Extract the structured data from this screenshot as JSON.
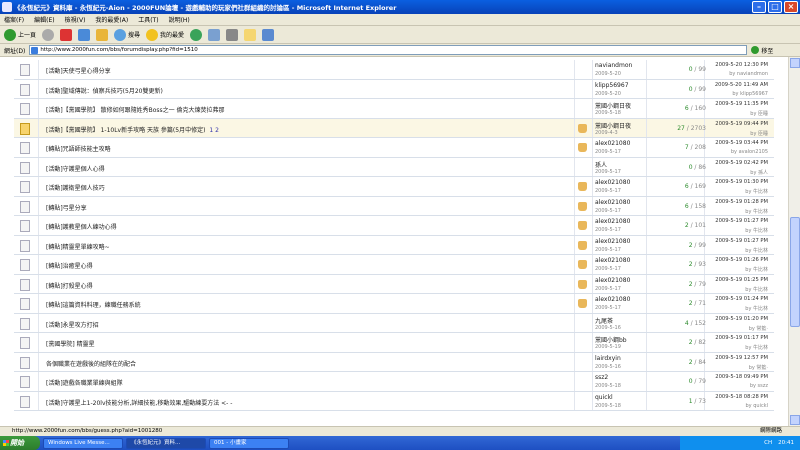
{
  "window": {
    "title": "《永恆紀元》資料庫 - 永恆紀元-Aion - 2000FUN論壇 - 遊戲輔助的玩家們社群組織的討論區 - Microsoft Internet Explorer"
  },
  "menu": [
    "檔案(F)",
    "編輯(E)",
    "檢視(V)",
    "我的最愛(A)",
    "工具(T)",
    "說明(H)"
  ],
  "toolbar": {
    "back": "上一頁",
    "search": "搜尋",
    "favorites": "我的最愛"
  },
  "address": {
    "label": "網址(D)",
    "url": "http://www.2000fun.com/bbs/forumdisplay.php?fid=1510",
    "go": "移至"
  },
  "threads": [
    {
      "title": "[活動]天使弓星心得分享",
      "author": "naviandmon",
      "adate": "2009-5-20",
      "replies": "0",
      "views": "99",
      "ldate": "2009-5-20 12:30 PM",
      "lby": "by naviandmon"
    },
    {
      "title": "[活動]聖域傳說：偵察兵技巧(5月20雙更新)",
      "author": "klipp56967",
      "adate": "2009-5-20",
      "replies": "0",
      "views": "99",
      "ldate": "2009-5-20 11:49 AM",
      "lby": "by klipp56967"
    },
    {
      "title": "[活動]【黨國學院】 散修如何跟隨姓秀Boss之一 倫克大煉焚拉弗那",
      "author": "黨國小鋼日夜",
      "adate": "2009-5-18",
      "replies": "6",
      "views": "160",
      "ldate": "2009-5-19 11:35 PM",
      "lby": "by 臣睡"
    },
    {
      "title": "[活動]【黨國學院】 1-10Lv新手攻略 天族 參篇(5月中修定)",
      "pages": "1 2",
      "author": "黨國小鋼日夜",
      "adate": "2009-4-3",
      "replies": "27",
      "views": "2703",
      "ldate": "2009-5-19 09:44 PM",
      "lby": "by 臣睡",
      "sticky": true,
      "thumb": true
    },
    {
      "title": "[轉貼]咒語師技能主攻略",
      "author": "alex021080",
      "adate": "2009-5-17",
      "replies": "7",
      "views": "208",
      "ldate": "2009-5-19 03:44 PM",
      "lby": "by avalon2105",
      "thumb": true
    },
    {
      "title": "[活動]守護星個人心得",
      "author": "孫人",
      "adate": "2009-5-17",
      "replies": "0",
      "views": "86",
      "ldate": "2009-5-19 02:42 PM",
      "lby": "by 孫人"
    },
    {
      "title": "[活動]護衛星個人技巧",
      "author": "alex021080",
      "adate": "2009-5-17",
      "replies": "6",
      "views": "169",
      "ldate": "2009-5-19 01:30 PM",
      "lby": "by 牛比林",
      "thumb": true
    },
    {
      "title": "[轉貼]弓星分享",
      "author": "alex021080",
      "adate": "2009-5-17",
      "replies": "6",
      "views": "158",
      "ldate": "2009-5-19 01:28 PM",
      "lby": "by 牛比林",
      "thumb": true
    },
    {
      "title": "[轉貼]護教星個人練功心得",
      "author": "alex021080",
      "adate": "2009-5-17",
      "replies": "2",
      "views": "101",
      "ldate": "2009-5-19 01:27 PM",
      "lby": "by 牛比林",
      "thumb": true
    },
    {
      "title": "[轉貼]精靈星單練攻略~",
      "author": "alex021080",
      "adate": "2009-5-17",
      "replies": "2",
      "views": "99",
      "ldate": "2009-5-19 01:27 PM",
      "lby": "by 牛比林",
      "thumb": true
    },
    {
      "title": "[轉貼]治癒星心得",
      "author": "alex021080",
      "adate": "2009-5-17",
      "replies": "2",
      "views": "93",
      "ldate": "2009-5-19 01:26 PM",
      "lby": "by 牛比林",
      "thumb": true
    },
    {
      "title": "[轉貼]打殺星心得",
      "author": "alex021080",
      "adate": "2009-5-17",
      "replies": "2",
      "views": "79",
      "ldate": "2009-5-19 01:25 PM",
      "lby": "by 牛比林",
      "thumb": true
    },
    {
      "title": "[轉貼]這篇資料料理，練職任務系統",
      "author": "alex021080",
      "adate": "2009-5-17",
      "replies": "2",
      "views": "71",
      "ldate": "2009-5-19 01:24 PM",
      "lby": "by 牛比林",
      "thumb": true
    },
    {
      "title": "[活動]永星攻方打招",
      "author": "九尾茶",
      "adate": "2009-5-16",
      "replies": "4",
      "views": "152",
      "ldate": "2009-5-19 01:20 PM",
      "lby": "by 常籃·"
    },
    {
      "title": "[黨國學院] 精靈星",
      "author": "黨國小鋼bb",
      "adate": "2009-5-19",
      "replies": "2",
      "views": "82",
      "ldate": "2009-5-19 01:17 PM",
      "lby": "by 牛比林"
    },
    {
      "title": "各個職業在遊戲後的組隊在的配合",
      "author": "lairdxyin",
      "adate": "2009-5-16",
      "replies": "2",
      "views": "84",
      "ldate": "2009-5-19 12:57 PM",
      "lby": "by 常籃·"
    },
    {
      "title": "[活動]遊戲各職業單練與組隊",
      "author": "ssz2",
      "adate": "2009-5-18",
      "replies": "0",
      "views": "79",
      "ldate": "2009-5-18 09:49 PM",
      "lby": "by sszz"
    },
    {
      "title": "[活動]守護星上1-20lv技能分析,詳細技能,移動效果,驅動練耍方法 <- -",
      "author": "quickl",
      "adate": "2009-5-18",
      "replies": "1",
      "views": "73",
      "ldate": "2009-5-18 08:28 PM",
      "lby": "by quickl"
    }
  ],
  "status": {
    "text": "http://www.2000fun.com/bbs/guess.php?aid=1001280",
    "zone": "網際網路"
  },
  "taskbar": {
    "start": "開始",
    "tasks": [
      "Windows Live Messe...",
      "《永恆紀元》資料...",
      "001 - 小畫家"
    ],
    "lang": "CH",
    "time": "20:41"
  }
}
